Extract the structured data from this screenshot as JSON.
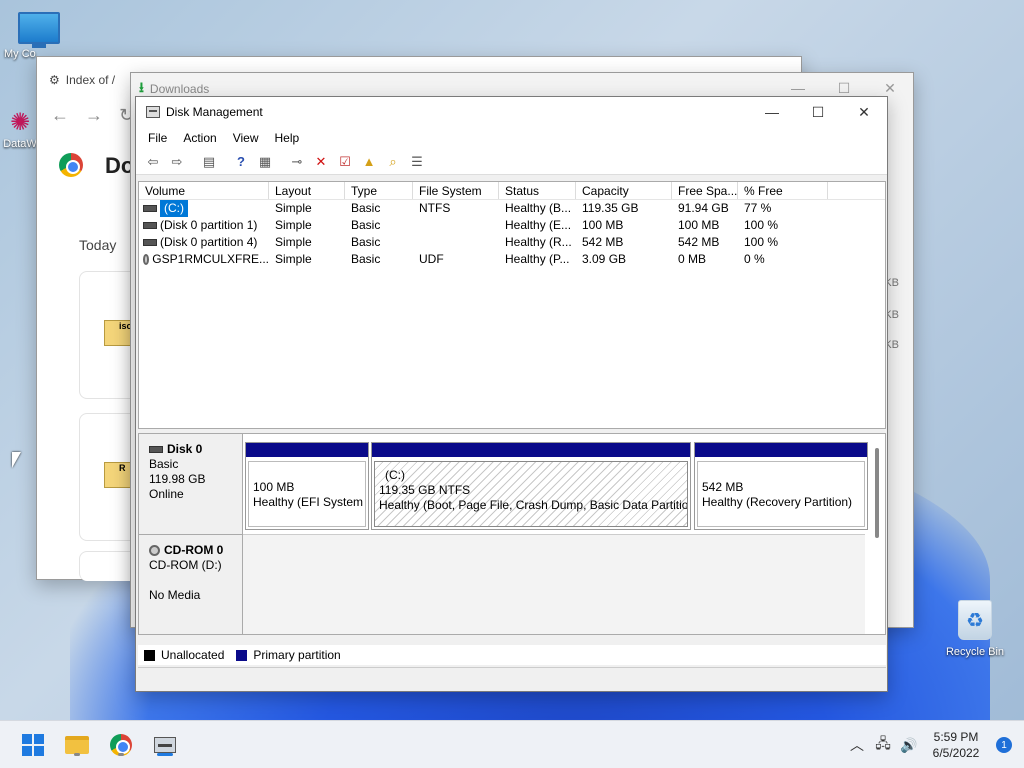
{
  "desktop": {
    "icons": [
      {
        "label": "My Co"
      },
      {
        "label": "DataW"
      },
      {
        "label": "Recycle Bin"
      }
    ]
  },
  "chrome": {
    "tab_title": "Index of /",
    "heading": "Do",
    "today": "Today",
    "file1": "iso",
    "file2": "R"
  },
  "downloads": {
    "title": "Downloads",
    "kb1": "KB",
    "kb2": "KB",
    "kb3": "KB"
  },
  "disk_management": {
    "title": "Disk Management",
    "menu": [
      "File",
      "Action",
      "View",
      "Help"
    ],
    "columns": [
      "Volume",
      "Layout",
      "Type",
      "File System",
      "Status",
      "Capacity",
      "Free Spa...",
      "% Free"
    ],
    "volumes": [
      {
        "volume": "(C:)",
        "layout": "Simple",
        "type": "Basic",
        "fs": "NTFS",
        "status": "Healthy (B...",
        "capacity": "119.35 GB",
        "free": "91.94 GB",
        "pct": "77 %"
      },
      {
        "volume": "(Disk 0 partition 1)",
        "layout": "Simple",
        "type": "Basic",
        "fs": "",
        "status": "Healthy (E...",
        "capacity": "100 MB",
        "free": "100 MB",
        "pct": "100 %"
      },
      {
        "volume": "(Disk 0 partition 4)",
        "layout": "Simple",
        "type": "Basic",
        "fs": "",
        "status": "Healthy (R...",
        "capacity": "542 MB",
        "free": "542 MB",
        "pct": "100 %"
      },
      {
        "volume": "GSP1RMCULXFRE...",
        "layout": "Simple",
        "type": "Basic",
        "fs": "UDF",
        "status": "Healthy (P...",
        "capacity": "3.09 GB",
        "free": "0 MB",
        "pct": "0 %"
      }
    ],
    "disk0": {
      "name": "Disk 0",
      "type": "Basic",
      "size": "119.98 GB",
      "state": "Online",
      "partitions": [
        {
          "line1": "100 MB",
          "line2": "Healthy (EFI System P"
        },
        {
          "title": "(C:)",
          "line1": "119.35 GB NTFS",
          "line2": "Healthy (Boot, Page File, Crash Dump, Basic Data Partition"
        },
        {
          "line1": "542 MB",
          "line2": "Healthy (Recovery Partition)"
        }
      ]
    },
    "cdrom": {
      "name": "CD-ROM 0",
      "drive": "CD-ROM (D:)",
      "media": "No Media"
    },
    "legend": [
      {
        "label": "Unallocated",
        "color": "#000000"
      },
      {
        "label": "Primary partition",
        "color": "#0a0a8a"
      }
    ]
  },
  "taskbar": {
    "time": "5:59 PM",
    "date": "6/5/2022",
    "notifications": "1"
  }
}
